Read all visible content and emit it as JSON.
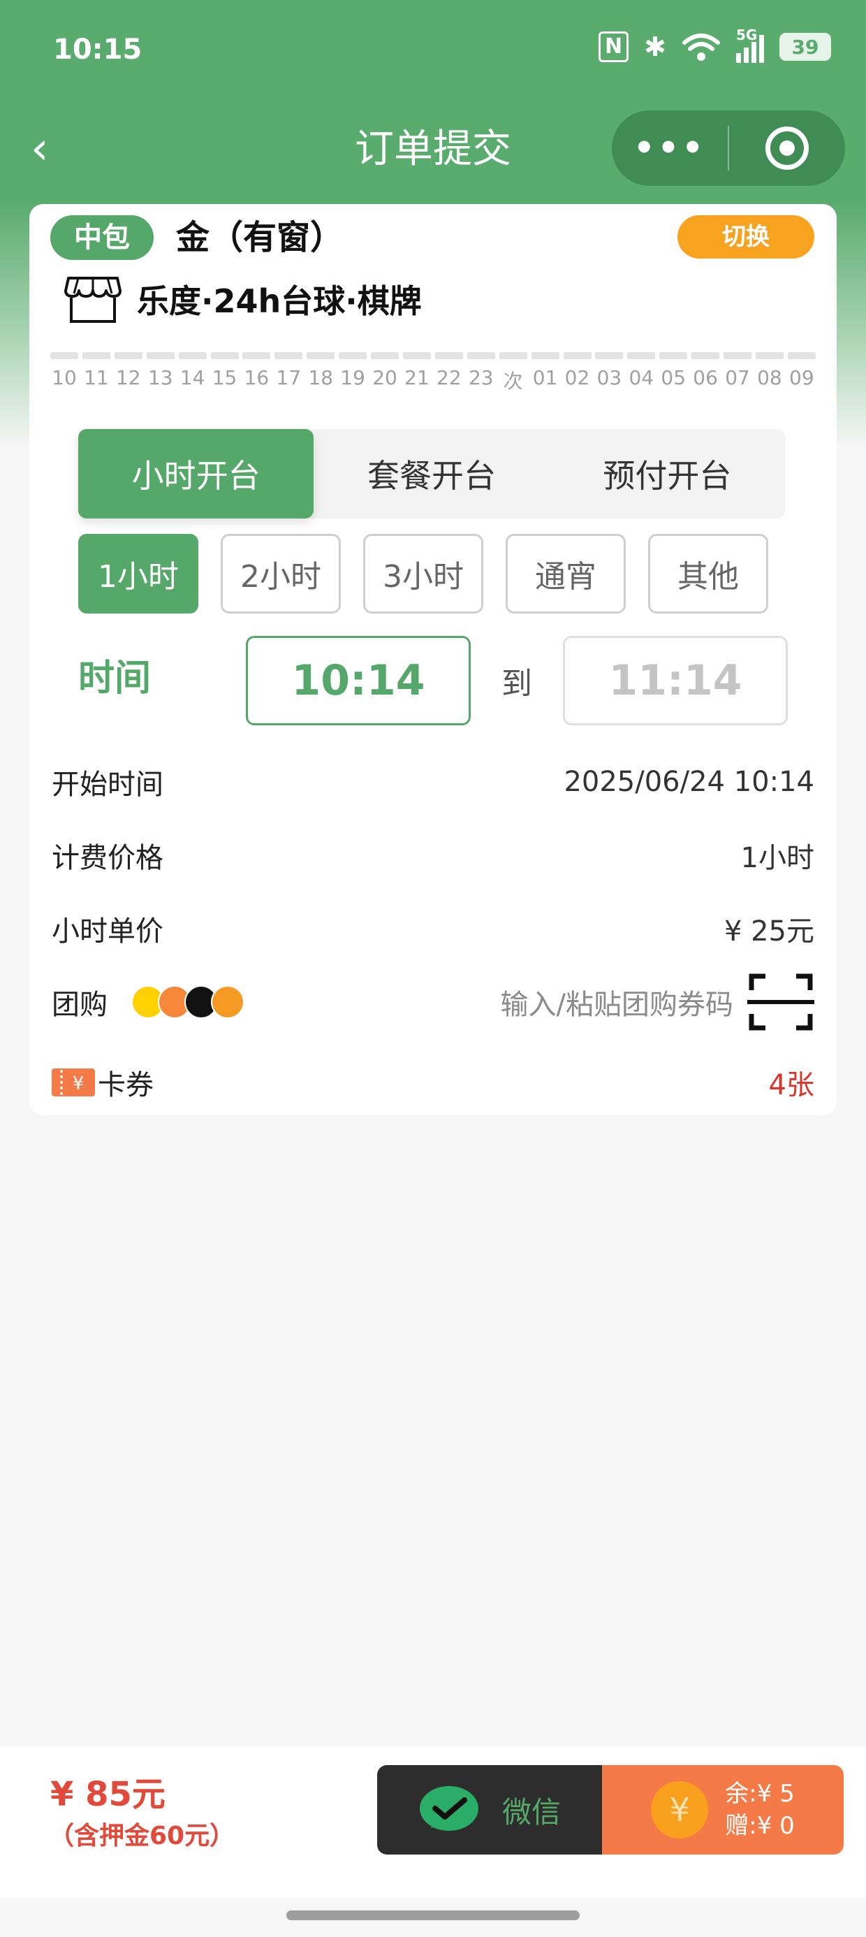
{
  "status_bar": {
    "time": "10:15",
    "nfc": "N",
    "bluetooth": "✱",
    "network": "5G",
    "battery": "39"
  },
  "nav": {
    "back": "‹",
    "title": "订单提交",
    "more": "•••"
  },
  "room": {
    "badge": "中包",
    "name": "金（有窗）",
    "switch_label": "切换"
  },
  "store": {
    "name": "乐度·24h台球·棋牌"
  },
  "timeline": [
    "10",
    "11",
    "12",
    "13",
    "14",
    "15",
    "16",
    "17",
    "18",
    "19",
    "20",
    "21",
    "22",
    "23",
    "次",
    "01",
    "02",
    "03",
    "04",
    "05",
    "06",
    "07",
    "08",
    "09"
  ],
  "mode_tabs": [
    {
      "label": "小时开台",
      "active": true
    },
    {
      "label": "套餐开台",
      "active": false
    },
    {
      "label": "预付开台",
      "active": false
    }
  ],
  "durations": [
    {
      "label": "1小时",
      "active": true
    },
    {
      "label": "2小时",
      "active": false
    },
    {
      "label": "3小时",
      "active": false
    },
    {
      "label": "通宵",
      "active": false
    },
    {
      "label": "其他",
      "active": false
    }
  ],
  "time": {
    "label": "时间",
    "start": "10:14",
    "to": "到",
    "end": "11:14"
  },
  "info": {
    "start_time_label": "开始时间",
    "start_time_value": "2025/06/24 10:14",
    "billing_label": "计费价格",
    "billing_value": "1小时",
    "unit_price_label": "小时单价",
    "unit_price_value": "¥ 25元",
    "group_label": "团购",
    "group_placeholder": "输入/粘贴团购券码",
    "coupon_label": "卡券",
    "coupon_value": "4张"
  },
  "bottom": {
    "total": "¥ 85元",
    "deposit": "（含押金60元）",
    "wechat_label": "微信",
    "balance_line1": "余:¥ 5",
    "balance_line2": "赠:¥ 0"
  },
  "colors": {
    "primary": "#56a86a",
    "accent_orange": "#f8a320",
    "price_red": "#e14a3a",
    "balance_bg": "#f47b47"
  }
}
